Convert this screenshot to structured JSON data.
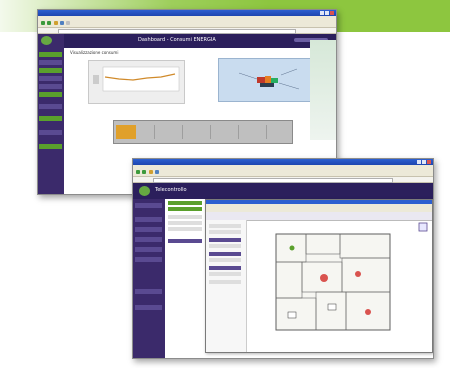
{
  "window1": {
    "header_title": "Dashboard - Consumi ENERGIA",
    "page_title": "Visualizzazione consumi",
    "chart_xlabel": "",
    "timeline_title": "",
    "timeline_labels": [],
    "footer_text": ""
  },
  "window2": {
    "header_title": "Telecontrollo",
    "user_text": ""
  },
  "colors": {
    "accent_green": "#8dc63f",
    "header_purple": "#2b1f5c",
    "sidebar_purple": "#3b2a6b",
    "timeline_orange": "#e0a02a"
  },
  "icons": [
    "minimize-icon",
    "maximize-icon",
    "close-icon",
    "logo-icon",
    "floor-plan-icon"
  ]
}
